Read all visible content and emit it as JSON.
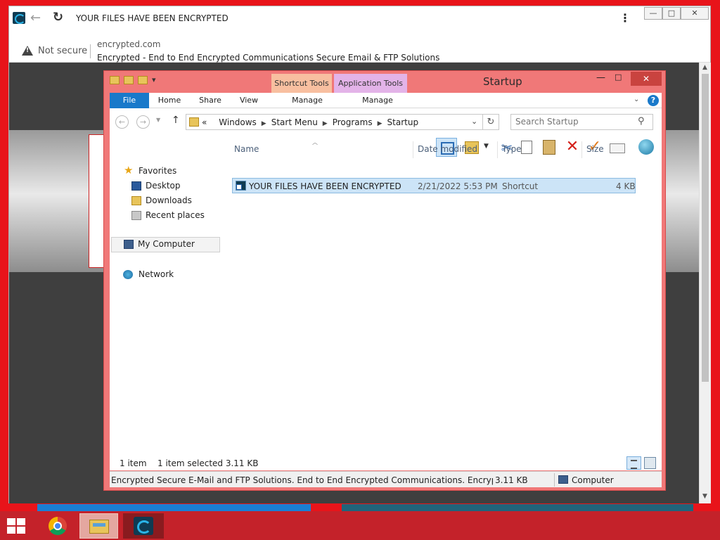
{
  "browser": {
    "title": "YOUR FILES HAVE BEEN ENCRYPTED",
    "security_label": "Not secure",
    "url": "encrypted.com",
    "page_title": "Encrypted - End to End Encrypted Communications Secure Email & FTP Solutions",
    "controls": {
      "minimize": "—",
      "maximize": "□",
      "close": "✕"
    }
  },
  "explorer": {
    "title": "Startup",
    "context_tabs": [
      "Shortcut Tools",
      "Application Tools"
    ],
    "ribbon_tabs": [
      "File",
      "Home",
      "Share",
      "View",
      "Manage",
      "Manage"
    ],
    "path": [
      "Windows",
      "Start Menu",
      "Programs",
      "Startup"
    ],
    "path_prefix": "«",
    "search_placeholder": "Search Startup",
    "nav_pane": {
      "favorites": "Favorites",
      "favorites_items": [
        "Desktop",
        "Downloads",
        "Recent places"
      ],
      "computer": "My Computer",
      "network": "Network"
    },
    "columns": [
      "Name",
      "Date modified",
      "Type",
      "Size"
    ],
    "files": [
      {
        "name": "YOUR FILES HAVE BEEN ENCRYPTED",
        "date": "2/21/2022 5:53 PM",
        "type": "Shortcut",
        "size": "4 KB"
      }
    ],
    "status": {
      "count": "1 item",
      "selected": "1 item selected  3.11 KB"
    },
    "info_bar": {
      "text": "Encrypted Secure E-Mail and FTP Solutions.  End to End Encrypted Communications. Encrypted.com er",
      "size": "3.11 KB",
      "location": "Computer"
    }
  },
  "colors": {
    "accent_red": "#e8141a",
    "explorer_frame": "#f07878",
    "file_tab": "#1979ca",
    "selection": "#cce4f7"
  },
  "icons": [
    "app-logo",
    "back-arrow",
    "reload",
    "warning-triangle",
    "folder",
    "star",
    "desktop",
    "computer",
    "network-globe",
    "cut",
    "copy",
    "paste",
    "delete",
    "rename",
    "properties",
    "search",
    "windows-logo",
    "chrome-logo",
    "explorer-logo"
  ]
}
